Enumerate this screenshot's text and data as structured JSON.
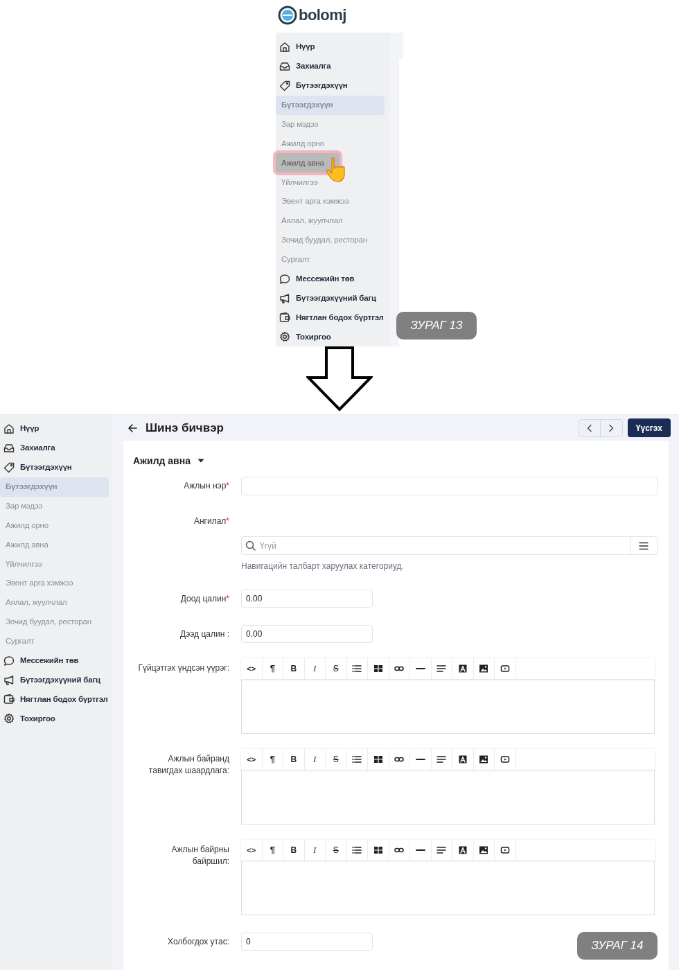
{
  "figures": [
    {
      "caption": "ЗУРАГ 13",
      "logo": {
        "text": "bolomj"
      },
      "sidebar": {
        "items": [
          {
            "label": "Нүүр",
            "kind": "main",
            "selected": false,
            "hovered": false
          },
          {
            "label": "Захиалга",
            "kind": "main",
            "selected": false,
            "hovered": false
          },
          {
            "label": "Бүтээгдэхүүн",
            "kind": "main",
            "selected": false,
            "hovered": false
          },
          {
            "label": "Бүтээгдэхүүн",
            "kind": "sub",
            "selected": true,
            "hovered": false
          },
          {
            "label": "Зар мэдээ",
            "kind": "sub",
            "selected": false,
            "hovered": false
          },
          {
            "label": "Ажилд орно",
            "kind": "sub",
            "selected": false,
            "hovered": false
          },
          {
            "label": "Ажилд авна",
            "kind": "sub",
            "selected": false,
            "hovered": true
          },
          {
            "label": "Үйлчилгээ",
            "kind": "sub",
            "selected": false,
            "hovered": false
          },
          {
            "label": "Эвент арга хэмжээ",
            "kind": "sub",
            "selected": false,
            "hovered": false
          },
          {
            "label": "Аялал, жуулчлал",
            "kind": "sub",
            "selected": false,
            "hovered": false
          },
          {
            "label": "Зочид буудал, ресторан",
            "kind": "sub",
            "selected": false,
            "hovered": false
          },
          {
            "label": "Сургалт",
            "kind": "sub",
            "selected": false,
            "hovered": false
          },
          {
            "label": "Мессежийн төв",
            "kind": "main",
            "selected": false,
            "hovered": false
          },
          {
            "label": "Бүтээгдэхүүний багц",
            "kind": "main",
            "selected": false,
            "hovered": false
          },
          {
            "label": "Нягтлан бодох бүртгэл",
            "kind": "main",
            "selected": false,
            "hovered": false
          },
          {
            "label": "Тохиргоо",
            "kind": "main",
            "selected": false,
            "hovered": false
          }
        ]
      }
    },
    {
      "caption": "ЗУРАГ 14",
      "sidebar": {
        "items": [
          {
            "label": "Нүүр",
            "kind": "main",
            "selected": false,
            "hovered": false
          },
          {
            "label": "Захиалга",
            "kind": "main",
            "selected": false,
            "hovered": false
          },
          {
            "label": "Бүтээгдэхүүн",
            "kind": "main",
            "selected": false,
            "hovered": false
          },
          {
            "label": "Бүтээгдэхүүн",
            "kind": "sub",
            "selected": true,
            "hovered": false
          },
          {
            "label": "Зар мэдээ",
            "kind": "sub",
            "selected": false,
            "hovered": false
          },
          {
            "label": "Ажилд орно",
            "kind": "sub",
            "selected": false,
            "hovered": false
          },
          {
            "label": "Ажилд авна",
            "kind": "sub",
            "selected": false,
            "hovered": false
          },
          {
            "label": "Үйлчилгээ",
            "kind": "sub",
            "selected": false,
            "hovered": false
          },
          {
            "label": "Эвент арга хэмжээ",
            "kind": "sub",
            "selected": false,
            "hovered": false
          },
          {
            "label": "Аялал, жуулчлал",
            "kind": "sub",
            "selected": false,
            "hovered": false
          },
          {
            "label": "Зочид буудал, ресторан",
            "kind": "sub",
            "selected": false,
            "hovered": false
          },
          {
            "label": "Сургалт",
            "kind": "sub",
            "selected": false,
            "hovered": false
          },
          {
            "label": "Мессежийн төв",
            "kind": "main",
            "selected": false,
            "hovered": false
          },
          {
            "label": "Бүтээгдэхүүний багц",
            "kind": "main",
            "selected": false,
            "hovered": false
          },
          {
            "label": "Нягтлан бодох бүртгэл",
            "kind": "main",
            "selected": false,
            "hovered": false
          },
          {
            "label": "Тохиргоо",
            "kind": "main",
            "selected": false,
            "hovered": false
          }
        ]
      },
      "page": {
        "title": "Шинэ бичвэр",
        "create_button": "Үүсгэх",
        "section": "Ажилд авна",
        "required_mark": "*",
        "fields": [
          {
            "kind": "text",
            "label": "Ажлын нэр",
            "required": true
          },
          {
            "kind": "category",
            "label": "Ангилал",
            "required": true,
            "placeholder": "Үгүй",
            "help": "Навигацийн талбарт харуулах категориуд."
          },
          {
            "kind": "number",
            "label": "Доод цалин",
            "required": true,
            "value": "0.00"
          },
          {
            "kind": "number",
            "label": "Дээд цалин :",
            "required": false,
            "value": "0.00"
          },
          {
            "kind": "richtext",
            "label": "Гүйцэтгэх үндсэн үүрэг:",
            "required": false,
            "toolbar": [
              {
                "kind": "code",
                "text": "<>"
              },
              {
                "kind": "paragraph",
                "text": "¶"
              },
              {
                "kind": "bold",
                "text": "B"
              },
              {
                "kind": "italic",
                "text": "I"
              },
              {
                "kind": "strike",
                "text": "S"
              },
              {
                "kind": "list"
              },
              {
                "kind": "table"
              },
              {
                "kind": "link"
              },
              {
                "kind": "rule"
              },
              {
                "kind": "align"
              },
              {
                "kind": "font"
              },
              {
                "kind": "image"
              },
              {
                "kind": "video"
              }
            ]
          },
          {
            "kind": "richtext",
            "label": "Ажлын байранд тавигдах шаардлага:",
            "required": false,
            "toolbar": [
              {
                "kind": "code",
                "text": "<>"
              },
              {
                "kind": "paragraph",
                "text": "¶"
              },
              {
                "kind": "bold",
                "text": "B"
              },
              {
                "kind": "italic",
                "text": "I"
              },
              {
                "kind": "strike",
                "text": "S"
              },
              {
                "kind": "list"
              },
              {
                "kind": "table"
              },
              {
                "kind": "link"
              },
              {
                "kind": "rule"
              },
              {
                "kind": "align"
              },
              {
                "kind": "font"
              },
              {
                "kind": "image"
              },
              {
                "kind": "video"
              }
            ]
          },
          {
            "kind": "richtext",
            "label": "Ажлын байрны байршил:",
            "required": false,
            "toolbar": [
              {
                "kind": "code",
                "text": "<>"
              },
              {
                "kind": "paragraph",
                "text": "¶"
              },
              {
                "kind": "bold",
                "text": "B"
              },
              {
                "kind": "italic",
                "text": "I"
              },
              {
                "kind": "strike",
                "text": "S"
              },
              {
                "kind": "list"
              },
              {
                "kind": "table"
              },
              {
                "kind": "link"
              },
              {
                "kind": "rule"
              },
              {
                "kind": "align"
              },
              {
                "kind": "font"
              },
              {
                "kind": "image"
              },
              {
                "kind": "video"
              }
            ]
          },
          {
            "kind": "number",
            "label": "Холбогдох утас:",
            "required": false,
            "value": "0"
          }
        ]
      }
    }
  ]
}
